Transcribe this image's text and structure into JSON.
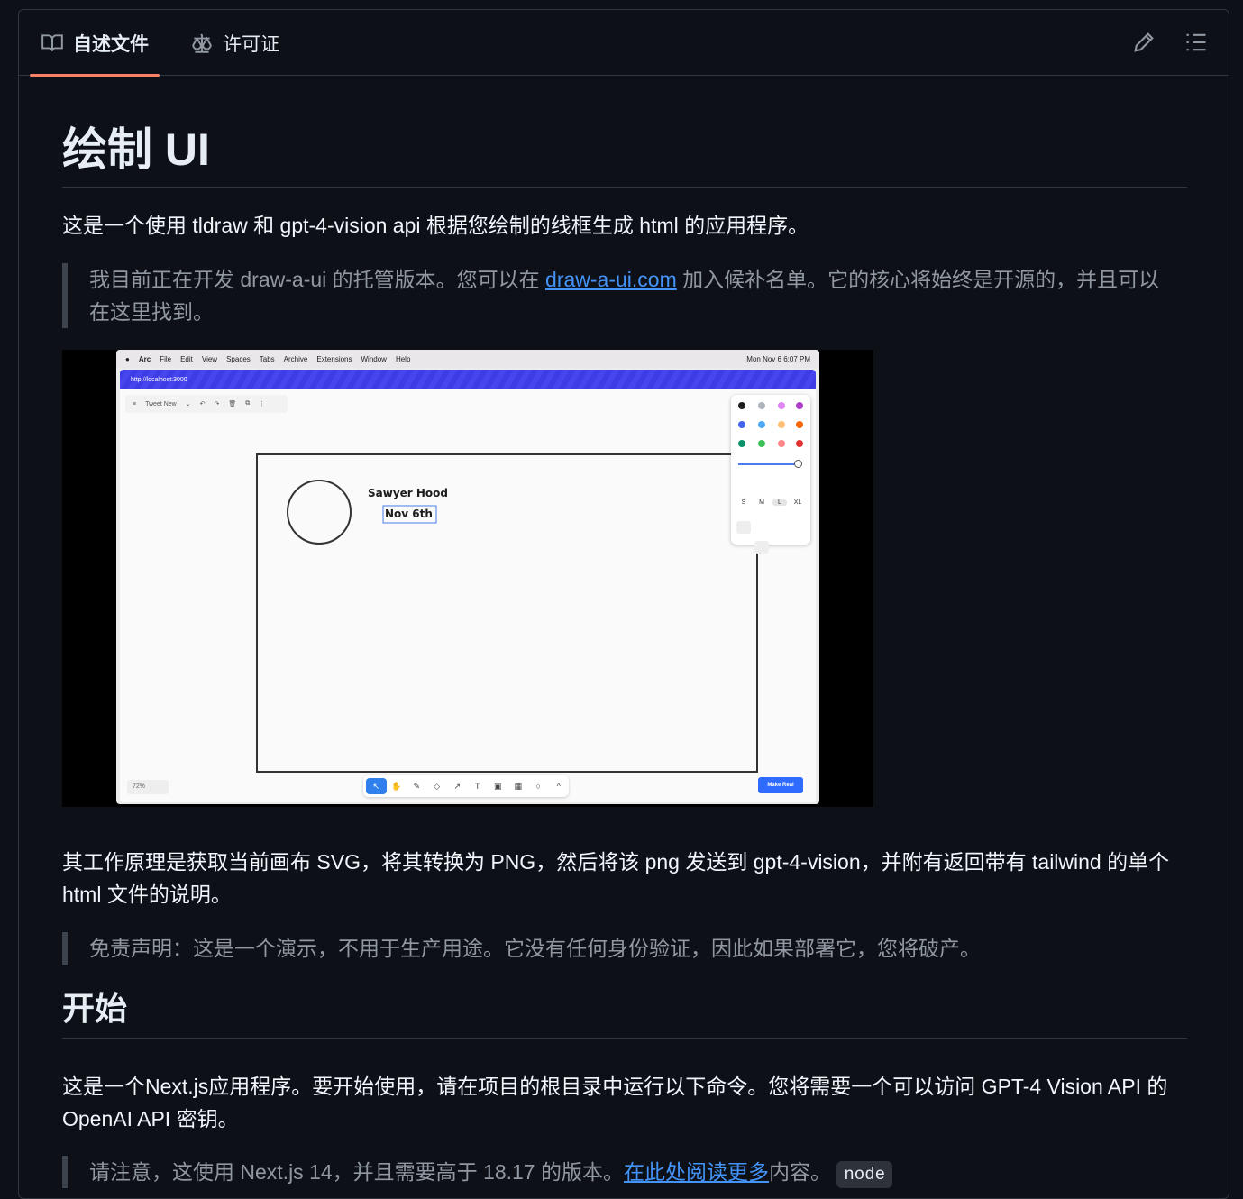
{
  "tabs": [
    {
      "label": "自述文件",
      "icon": "book-icon"
    },
    {
      "label": "许可证",
      "icon": "scale-icon"
    }
  ],
  "toolbar_icons": [
    "pencil-icon",
    "list-icon"
  ],
  "readme": {
    "title": "绘制 UI",
    "intro": "这是一个使用 tldraw 和 gpt-4-vision api 根据您绘制的线框生成 html 的应用程序。",
    "quote1": {
      "before": "我目前正在开发 draw-a-ui 的托管版本。您可以在 ",
      "link": "draw-a-ui.com",
      "after": " 加入候补名单。它的核心将始终是开源的，并且可以在这里找到。"
    },
    "how_it_works": "其工作原理是获取当前画布 SVG，将其转换为 PNG，然后将该 png 发送到 gpt-4-vision，并附有返回带有 tailwind 的单个 html 文件的说明。",
    "disclaimer": "免责声明：这是一个演示，不用于生产用途。它没有任何身份验证，因此如果部署它，您将破产。",
    "heading_start": "开始",
    "start_text": "这是一个Next.js应用程序。要开始使用，请在项目的根目录中运行以下命令。您将需要一个可以访问 GPT-4 Vision API 的 OpenAI API 密钥。",
    "note": {
      "before": "请注意，这使用 Next.js 14，并且需要高于 18.17 的版本。",
      "link": "在此处阅读更多",
      "after": "内容。",
      "code": "node"
    }
  },
  "screenshot": {
    "menubar": [
      "Arc",
      "File",
      "Edit",
      "View",
      "Spaces",
      "Tabs",
      "Archive",
      "Extensions",
      "Window",
      "Help"
    ],
    "clock": "Mon Nov 6  6:07 PM",
    "url": "http://localhost:3000",
    "tl_toolbar": [
      "≡",
      "Tweet New",
      "⌄",
      "↶",
      "↷",
      "🗑",
      "⧉",
      "⋮"
    ],
    "canvas_name": "Sawyer Hood",
    "canvas_date": "Nov 6th",
    "sizes": [
      "S",
      "M",
      "L",
      "XL"
    ],
    "zoom": "72%",
    "tools": [
      "↖",
      "✋",
      "✎",
      "◇",
      "↗",
      "T",
      "▣",
      "▦",
      "○",
      "^"
    ],
    "make_real": "Make Real"
  },
  "colors": {
    "accent_underline": "#f78166",
    "link": "#4493f8",
    "background": "#0d1117",
    "border": "#30363d"
  }
}
